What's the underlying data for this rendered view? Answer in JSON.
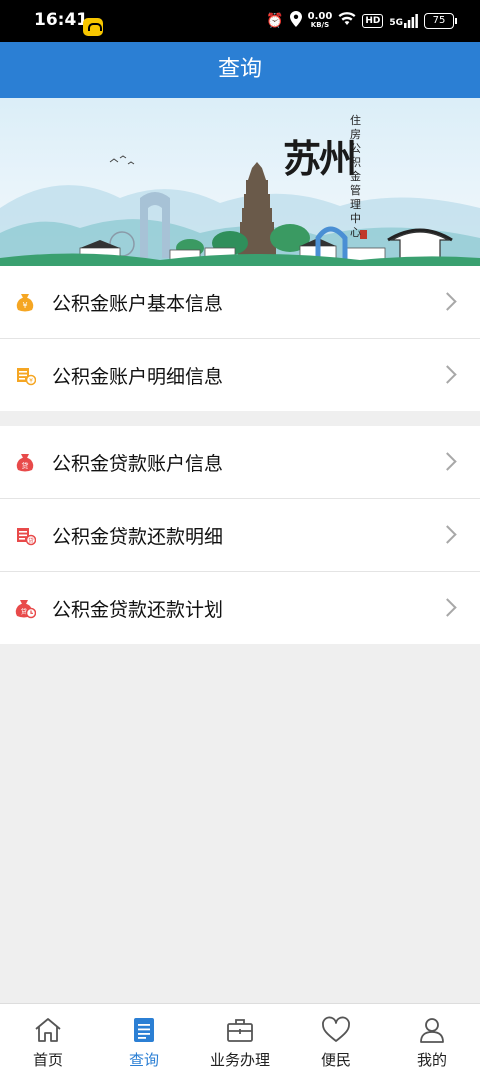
{
  "status_bar": {
    "time": "16:41",
    "net_speed_value": "0.00",
    "net_speed_unit": "KB/S",
    "hd_badge": "HD",
    "signal_label": "5G",
    "battery": "75"
  },
  "header": {
    "title": "查询"
  },
  "banner": {
    "title": "苏州",
    "subtitle": "住房公积金管理中心"
  },
  "menu": {
    "group1": [
      {
        "label": "公积金账户基本信息",
        "icon": "money-bag-icon",
        "color": "#f5a623"
      },
      {
        "label": "公积金账户明细信息",
        "icon": "coin-list-icon",
        "color": "#f5a623"
      }
    ],
    "group2": [
      {
        "label": "公积金贷款账户信息",
        "icon": "loan-bag-icon",
        "color": "#e84a4a"
      },
      {
        "label": "公积金贷款还款明细",
        "icon": "loan-list-icon",
        "color": "#e84a4a"
      },
      {
        "label": "公积金贷款还款计划",
        "icon": "loan-plan-icon",
        "color": "#e84a4a"
      }
    ]
  },
  "tabbar": {
    "items": [
      {
        "label": "首页",
        "icon": "home-icon"
      },
      {
        "label": "查询",
        "icon": "query-doc-icon",
        "active": true
      },
      {
        "label": "业务办理",
        "icon": "briefcase-icon"
      },
      {
        "label": "便民",
        "icon": "heart-icon"
      },
      {
        "label": "我的",
        "icon": "user-icon"
      }
    ]
  },
  "colors": {
    "primary": "#2b7fd4",
    "accent_orange": "#f5a623",
    "accent_red": "#e84a4a",
    "background": "#efefef"
  }
}
